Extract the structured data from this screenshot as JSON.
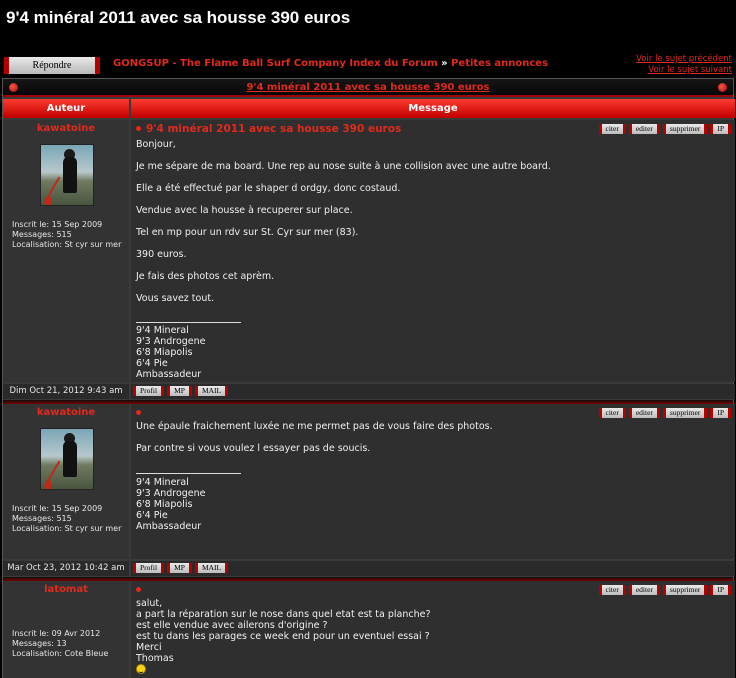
{
  "page": {
    "title": "9'4 minéral 2011 avec sa housse 390 euros"
  },
  "toolbar": {
    "reply_label": "Répondre"
  },
  "breadcrumb": {
    "forum_index": "GONGSUP - The Flame Ball Surf Company Index du Forum",
    "separator": "»",
    "section": "Petites annonces"
  },
  "topic_nav": {
    "previous": "Voir le sujet précédent",
    "next": "Voir le sujet suivant"
  },
  "topic_bar": {
    "title": "9'4 minéral 2011 avec sa housse 390 euros"
  },
  "columns": {
    "author": "Auteur",
    "message": "Message"
  },
  "post_buttons": {
    "quote": "citer",
    "edit": "editer",
    "delete": "supprimer",
    "ip": "IP"
  },
  "footer_buttons": {
    "profile": "Profil",
    "pm": "MP",
    "mail": "MAIL"
  },
  "posts": [
    {
      "author": "kawatoine",
      "registered": "Inscrit le: 15 Sep 2009",
      "messages": "Messages: 515",
      "location": "Localisation: St cyr sur mer",
      "title": "9'4 minéral 2011 avec sa housse 390 euros",
      "paragraphs": [
        "Bonjour,",
        "Je me sépare de ma board. Une rep au nose suite à une collision avec une autre board.",
        "Elle a été effectué par le shaper d ordgy, donc costaud.",
        "Vendue avec la housse à recuperer sur place.",
        "Tel en mp pour un rdv sur St. Cyr sur mer (83).",
        "390 euros.",
        "Je fais des photos cet aprèm.",
        "Vous savez tout."
      ],
      "signature": [
        "9'4 Mineral",
        "9'3 Androgene",
        "6'8 Miapolis",
        "6'4 Pie",
        "Ambassadeur"
      ],
      "date": "Dim Oct 21, 2012 9:43 am"
    },
    {
      "author": "kawatoine",
      "registered": "Inscrit le: 15 Sep 2009",
      "messages": "Messages: 515",
      "location": "Localisation: St cyr sur mer",
      "paragraphs": [
        "Une épaule fraichement luxée ne me permet pas de vous faire des photos.",
        "Par contre si vous voulez l essayer pas de soucis."
      ],
      "signature": [
        "9'4 Mineral",
        "9'3 Androgene",
        "6'8 Miapolis",
        "6'4 Pie",
        "Ambassadeur"
      ],
      "date": "Mar Oct 23, 2012 10:42 am"
    },
    {
      "author": "latomat",
      "registered": "Inscrit le: 09 Avr 2012",
      "messages": "Messages: 13",
      "location": "Localisation: Cote Bleue",
      "lines": [
        "salut,",
        "a part la réparation sur le nose dans quel etat est ta planche?",
        "est elle vendue avec ailerons d'origine ?",
        "est tu dans les parages ce week end pour un eventuel essai ?",
        "Merci",
        "Thomas"
      ],
      "smiley_icon": "smiley-icon"
    }
  ]
}
